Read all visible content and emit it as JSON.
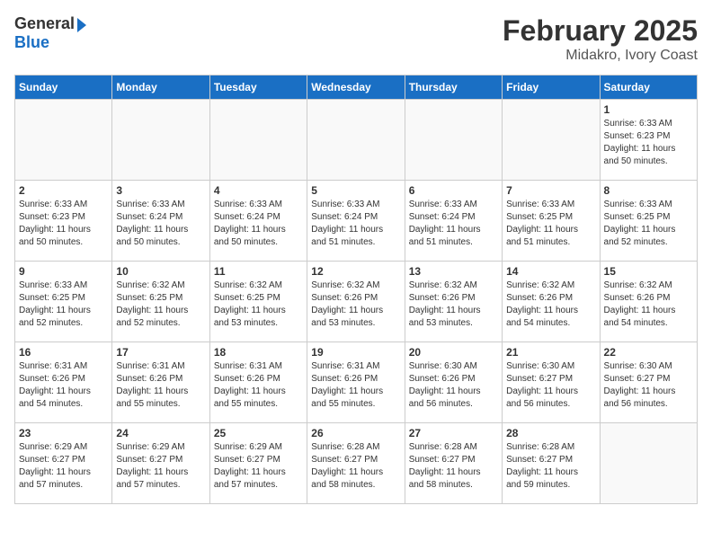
{
  "header": {
    "logo_general": "General",
    "logo_blue": "Blue",
    "month_title": "February 2025",
    "location": "Midakro, Ivory Coast"
  },
  "days_of_week": [
    "Sunday",
    "Monday",
    "Tuesday",
    "Wednesday",
    "Thursday",
    "Friday",
    "Saturday"
  ],
  "weeks": [
    {
      "days": [
        {
          "num": "",
          "info": ""
        },
        {
          "num": "",
          "info": ""
        },
        {
          "num": "",
          "info": ""
        },
        {
          "num": "",
          "info": ""
        },
        {
          "num": "",
          "info": ""
        },
        {
          "num": "",
          "info": ""
        },
        {
          "num": "1",
          "info": "Sunrise: 6:33 AM\nSunset: 6:23 PM\nDaylight: 11 hours\nand 50 minutes."
        }
      ]
    },
    {
      "days": [
        {
          "num": "2",
          "info": "Sunrise: 6:33 AM\nSunset: 6:23 PM\nDaylight: 11 hours\nand 50 minutes."
        },
        {
          "num": "3",
          "info": "Sunrise: 6:33 AM\nSunset: 6:24 PM\nDaylight: 11 hours\nand 50 minutes."
        },
        {
          "num": "4",
          "info": "Sunrise: 6:33 AM\nSunset: 6:24 PM\nDaylight: 11 hours\nand 50 minutes."
        },
        {
          "num": "5",
          "info": "Sunrise: 6:33 AM\nSunset: 6:24 PM\nDaylight: 11 hours\nand 51 minutes."
        },
        {
          "num": "6",
          "info": "Sunrise: 6:33 AM\nSunset: 6:24 PM\nDaylight: 11 hours\nand 51 minutes."
        },
        {
          "num": "7",
          "info": "Sunrise: 6:33 AM\nSunset: 6:25 PM\nDaylight: 11 hours\nand 51 minutes."
        },
        {
          "num": "8",
          "info": "Sunrise: 6:33 AM\nSunset: 6:25 PM\nDaylight: 11 hours\nand 52 minutes."
        }
      ]
    },
    {
      "days": [
        {
          "num": "9",
          "info": "Sunrise: 6:33 AM\nSunset: 6:25 PM\nDaylight: 11 hours\nand 52 minutes."
        },
        {
          "num": "10",
          "info": "Sunrise: 6:32 AM\nSunset: 6:25 PM\nDaylight: 11 hours\nand 52 minutes."
        },
        {
          "num": "11",
          "info": "Sunrise: 6:32 AM\nSunset: 6:25 PM\nDaylight: 11 hours\nand 53 minutes."
        },
        {
          "num": "12",
          "info": "Sunrise: 6:32 AM\nSunset: 6:26 PM\nDaylight: 11 hours\nand 53 minutes."
        },
        {
          "num": "13",
          "info": "Sunrise: 6:32 AM\nSunset: 6:26 PM\nDaylight: 11 hours\nand 53 minutes."
        },
        {
          "num": "14",
          "info": "Sunrise: 6:32 AM\nSunset: 6:26 PM\nDaylight: 11 hours\nand 54 minutes."
        },
        {
          "num": "15",
          "info": "Sunrise: 6:32 AM\nSunset: 6:26 PM\nDaylight: 11 hours\nand 54 minutes."
        }
      ]
    },
    {
      "days": [
        {
          "num": "16",
          "info": "Sunrise: 6:31 AM\nSunset: 6:26 PM\nDaylight: 11 hours\nand 54 minutes."
        },
        {
          "num": "17",
          "info": "Sunrise: 6:31 AM\nSunset: 6:26 PM\nDaylight: 11 hours\nand 55 minutes."
        },
        {
          "num": "18",
          "info": "Sunrise: 6:31 AM\nSunset: 6:26 PM\nDaylight: 11 hours\nand 55 minutes."
        },
        {
          "num": "19",
          "info": "Sunrise: 6:31 AM\nSunset: 6:26 PM\nDaylight: 11 hours\nand 55 minutes."
        },
        {
          "num": "20",
          "info": "Sunrise: 6:30 AM\nSunset: 6:26 PM\nDaylight: 11 hours\nand 56 minutes."
        },
        {
          "num": "21",
          "info": "Sunrise: 6:30 AM\nSunset: 6:27 PM\nDaylight: 11 hours\nand 56 minutes."
        },
        {
          "num": "22",
          "info": "Sunrise: 6:30 AM\nSunset: 6:27 PM\nDaylight: 11 hours\nand 56 minutes."
        }
      ]
    },
    {
      "days": [
        {
          "num": "23",
          "info": "Sunrise: 6:29 AM\nSunset: 6:27 PM\nDaylight: 11 hours\nand 57 minutes."
        },
        {
          "num": "24",
          "info": "Sunrise: 6:29 AM\nSunset: 6:27 PM\nDaylight: 11 hours\nand 57 minutes."
        },
        {
          "num": "25",
          "info": "Sunrise: 6:29 AM\nSunset: 6:27 PM\nDaylight: 11 hours\nand 57 minutes."
        },
        {
          "num": "26",
          "info": "Sunrise: 6:28 AM\nSunset: 6:27 PM\nDaylight: 11 hours\nand 58 minutes."
        },
        {
          "num": "27",
          "info": "Sunrise: 6:28 AM\nSunset: 6:27 PM\nDaylight: 11 hours\nand 58 minutes."
        },
        {
          "num": "28",
          "info": "Sunrise: 6:28 AM\nSunset: 6:27 PM\nDaylight: 11 hours\nand 59 minutes."
        },
        {
          "num": "",
          "info": ""
        }
      ]
    }
  ]
}
